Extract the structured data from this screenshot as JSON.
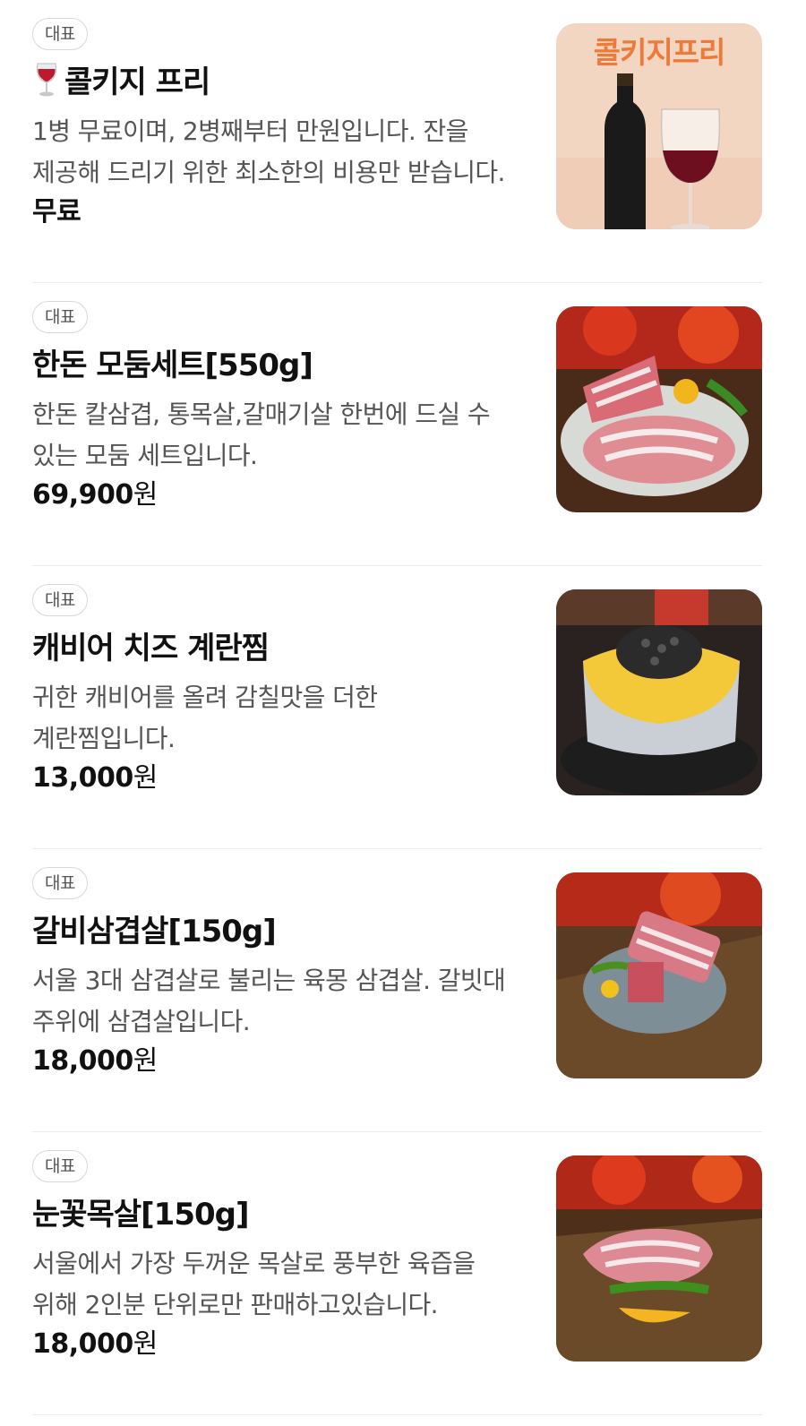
{
  "menu": {
    "items": [
      {
        "badge": "대표",
        "title": "콜키지 프리",
        "title_icon": "wine-glass-icon",
        "description": "1병 무료이며, 2병째부터 만원입니다. 잔을 제공해 드리기 위한 최소한의 비용만 받습니다.",
        "price": "무료",
        "price_unit": "",
        "image_text": "콜키지프리"
      },
      {
        "badge": "대표",
        "title": "한돈 모둠세트[550g]",
        "description": "한돈 칼삼겹, 통목살,갈매기살 한번에 드실 수 있는 모둠 세트입니다.",
        "price": "69,900",
        "price_unit": "원"
      },
      {
        "badge": "대표",
        "title": "캐비어 치즈 계란찜",
        "description": "귀한 캐비어를 올려 감칠맛을 더한 계란찜입니다.",
        "price": "13,000",
        "price_unit": "원"
      },
      {
        "badge": "대표",
        "title": "갈비삼겹살[150g]",
        "description": "서울 3대 삼겹살로 불리는 육몽 삼겹살. 갈빗대 주위에 삼겹살입니다.",
        "price": "18,000",
        "price_unit": "원"
      },
      {
        "badge": "대표",
        "title": "눈꽃목살[150g]",
        "description": "서울에서 가장 두꺼운 목살로 풍부한 육즙을 위해 2인분 단위로만 판매하고있습니다.",
        "price": "18,000",
        "price_unit": "원"
      }
    ]
  }
}
